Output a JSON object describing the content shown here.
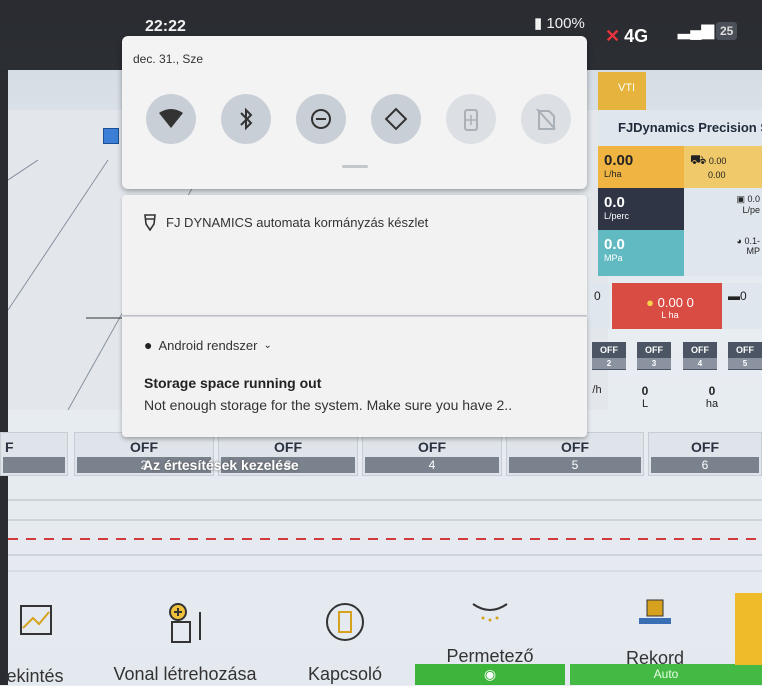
{
  "status_bar": {
    "time": "22:22",
    "battery": "100%",
    "network": "4G",
    "signal_badge": "25"
  },
  "quick_settings": {
    "date": "dec. 31., Sze",
    "tiles": [
      {
        "name": "wifi",
        "state": "on"
      },
      {
        "name": "bluetooth",
        "state": "on"
      },
      {
        "name": "do-not-disturb",
        "state": "on"
      },
      {
        "name": "auto-rotate",
        "state": "on"
      },
      {
        "name": "battery-saver",
        "state": "off"
      },
      {
        "name": "sim-card",
        "state": "off"
      }
    ]
  },
  "notifications": [
    {
      "app": "FJ DYNAMICS automata kormányzás készlet"
    },
    {
      "app": "Android rendszer",
      "title": "Storage space running out",
      "body": "Not enough storage for the system. Make sure you have 2.."
    }
  ],
  "manage_notifications": "Az értesítések kezelése",
  "background_app": {
    "vti_tab": "VTI",
    "panel_title": "FJDynamics Precision S",
    "cells": {
      "rate_value": "0.00",
      "rate_unit": "L/ha",
      "rate2_value": "0.00",
      "rate2_sub": "0.00",
      "flow_value": "0.0",
      "flow_unit": "L/perc",
      "flow2_value": "0.0",
      "flow2_unit": "L/pe",
      "press_value": "0.0",
      "press_unit": "MPa",
      "press2_value": "0.1-",
      "press2_unit": "MP",
      "vol_left": "0",
      "vol_value": "0.00 0",
      "vol_units": "L   ha",
      "vol_right": "0"
    },
    "small_sections": [
      {
        "label": "OFF",
        "num": "2"
      },
      {
        "label": "OFF",
        "num": "3"
      },
      {
        "label": "OFF",
        "num": "4"
      },
      {
        "label": "OFF",
        "num": "5"
      }
    ],
    "stats": [
      {
        "value": "",
        "unit": "/h"
      },
      {
        "value": "0",
        "unit": "L"
      },
      {
        "value": "0",
        "unit": "ha"
      }
    ],
    "sections": [
      {
        "label": "F",
        "num": ""
      },
      {
        "label": "OFF",
        "num": "2"
      },
      {
        "label": "OFF",
        "num": "3"
      },
      {
        "label": "OFF",
        "num": "4"
      },
      {
        "label": "OFF",
        "num": "5"
      },
      {
        "label": "OFF",
        "num": "6"
      }
    ],
    "toolbar": {
      "view": "ekintés",
      "create_line": "Vonal létrehozása",
      "switch": "Kapcsoló",
      "sprayer": "Permetező",
      "record": "Rekord",
      "auto": "Auto"
    }
  }
}
